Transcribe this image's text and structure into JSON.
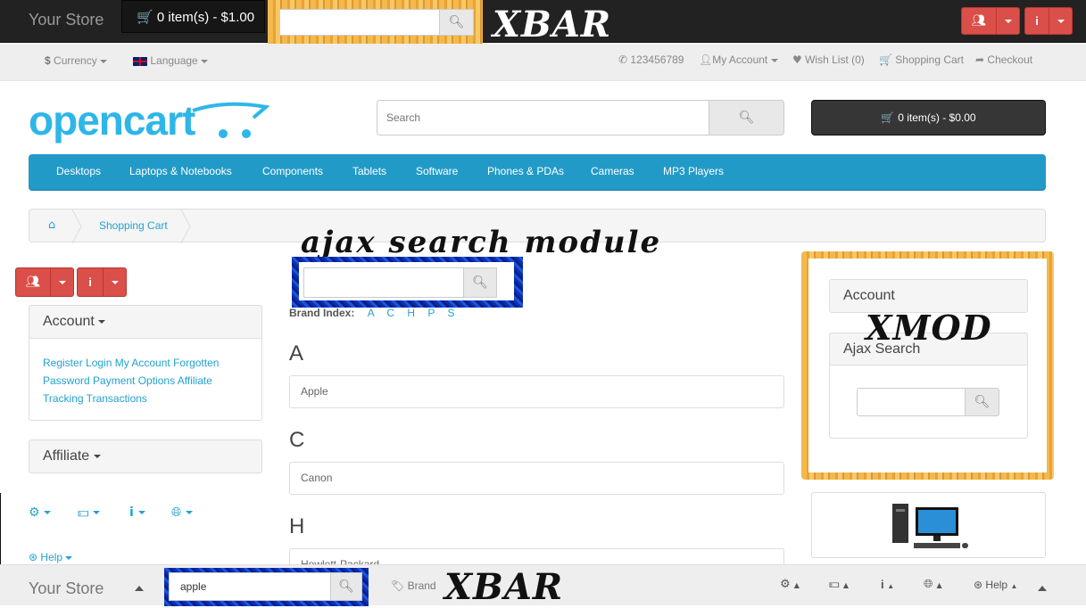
{
  "xbar_top": {
    "store_name": "Your Store",
    "cart_label": "0 item(s) - $1.00",
    "search_value": "",
    "label": "XBAR"
  },
  "links_bar": {
    "currency": "Currency",
    "language": "Language",
    "phone": "123456789",
    "my_account": "My Account",
    "wish_list": "Wish List (0)",
    "shopping_cart": "Shopping Cart",
    "checkout": "Checkout"
  },
  "header": {
    "logo_text": "opencart",
    "search_placeholder": "Search",
    "cart_label": "0 item(s) - $0.00"
  },
  "menu": {
    "items": [
      "Desktops",
      "Laptops & Notebooks",
      "Components",
      "Tablets",
      "Software",
      "Phones & PDAs",
      "Cameras",
      "MP3 Players"
    ]
  },
  "breadcrumb": {
    "current": "Shopping Cart"
  },
  "left_column": {
    "account_title": "Account",
    "account_links_line1": "Register Login My Account Forgotten",
    "account_links_line2": "Password Payment Options Affiliate",
    "account_links_line3": "Tracking Transactions",
    "affiliate_title": "Affiliate",
    "help_label": "Help"
  },
  "center": {
    "overlay_title": "ajax search module",
    "brand_index_label": "Brand Index:",
    "brand_letters": [
      "A",
      "C",
      "H",
      "P",
      "S"
    ],
    "groups": [
      {
        "letter": "A",
        "brand": "Apple"
      },
      {
        "letter": "C",
        "brand": "Canon"
      },
      {
        "letter": "H",
        "brand": "Hewlett-Packard"
      }
    ]
  },
  "right_column": {
    "account_title": "Account",
    "xmod_label": "XMOD",
    "ajax_search_title": "Ajax Search",
    "search_value": ""
  },
  "xbar_bottom": {
    "store_name": "Your Store",
    "search_value": "apple",
    "brand_label": "Brand",
    "label": "XBAR",
    "help_label": "Help"
  },
  "colors": {
    "top_bar": "#222222",
    "menu": "#229ac8",
    "link": "#23a1d1",
    "red_button": "#da4f49",
    "wood_frame": "#f3b94c",
    "blue_frame": "#0b2fb3"
  }
}
